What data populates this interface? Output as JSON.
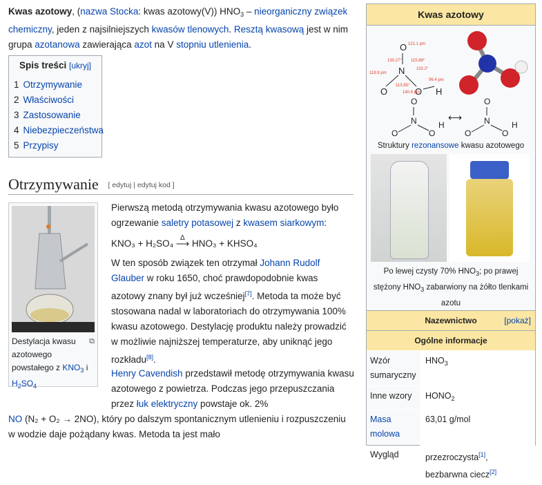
{
  "intro": {
    "title_bold": "Kwas azotowy",
    "p1": ", (",
    "stocka_link": "nazwa Stocka",
    "p2": ": kwas azotowy(V)) HNO",
    "p2_sub": "3",
    "p3": " – ",
    "link_nieorg": "nieorganiczny związek chemiczny",
    "p4": ", jeden z najsilniejszych ",
    "link_kwasow": "kwasów tlenowych",
    "p5": ". ",
    "link_reszta": "Resztą kwasową",
    "p6": " jest w nim grupa ",
    "link_azotanowa": "azotanowa",
    "p7": " zawierająca ",
    "link_azot": "azot",
    "p8": " na V ",
    "link_stopniu": "stopniu utlenienia",
    "p9": "."
  },
  "toc": {
    "title": "Spis treści",
    "toggle": "[ukryj]",
    "items": [
      {
        "num": "1",
        "label": "Otrzymywanie"
      },
      {
        "num": "2",
        "label": "Właściwości"
      },
      {
        "num": "3",
        "label": "Zastosowanie"
      },
      {
        "num": "4",
        "label": "Niebezpieczeństwa"
      },
      {
        "num": "5",
        "label": "Przypisy"
      }
    ]
  },
  "section": {
    "title": "Otrzymywanie",
    "edit": "[ edytuj | edytuj kod ]"
  },
  "thumb": {
    "caption1": "Destylacja kwasu azotowego powstałego z ",
    "caption_link": "KNO",
    "caption_sub": "3",
    "caption2": " i ",
    "caption_link2": "H",
    "caption_sub2": "2",
    "caption_link2b": "SO",
    "caption_sub3": "4"
  },
  "body": {
    "p1a": "Pierwszą metodą otrzymywania kwasu azotowego było ogrzewanie ",
    "p1_link1": "saletry potasowej",
    "p1b": " z ",
    "p1_link2": "kwasem siarkowym",
    "p1c": ":",
    "eq": "KNO₃ + H₂SO₄ ⟶ HNO₃ + KHSO₄",
    "eq_delta": "Δ",
    "p2a": "W ten sposób związek ten otrzymał ",
    "p2_link": "Johann Rudolf Glauber",
    "p2b": " w roku 1650, choć prawdopodobnie kwas azotowy znany był już wcześniej",
    "p2_ref1": "[7]",
    "p2c": ". Metoda ta może być stosowana nadal w laboratoriach do otrzymywania 100% kwasu azotowego. Destylację produktu należy prowadzić w możliwie najniższej temperaturze, aby uniknąć jego rozkładu",
    "p2_ref2": "[8]",
    "p2d": ".",
    "p3_link": "Henry Cavendish",
    "p3a": " przedstawił metodę otrzymywania kwasu azotowego z powietrza. Podczas jego przepuszczania przez ",
    "p3_link2": "łuk elektryczny",
    "p3b": " powstaje ok. 2%",
    "p4_link": "NO",
    "p4a": " (N₂ + O₂ → 2NO), który po dalszym spontanicznym utlenieniu i rozpuszczeniu w wodzie daje pożądany kwas. Metoda ta jest mało"
  },
  "infobox": {
    "title": "Kwas azotowy",
    "angles": [
      "130.27°",
      "121.1 pm",
      "115.88°",
      "102.2°",
      "119.9 pm",
      "113.85°",
      "140.6 pm",
      "96.4 pm"
    ],
    "atom_labels": {
      "O": "O",
      "N": "N",
      "H": "H"
    },
    "resonance_caption_a": "Struktury ",
    "resonance_link": "rezonansowe",
    "resonance_caption_b": " kwasu azotowego",
    "photo_caption_a": "Po lewej czysty 70% HNO",
    "photo_caption_sub": "3",
    "photo_caption_b": "; po prawej stężony HNO",
    "photo_caption_sub2": "3",
    "photo_caption_c": " zabarwiony na żółto tlenkami azotu",
    "nazewnictwo": "Nazewnictwo",
    "pokaz": "[pokaż]",
    "ogolne": "Ogólne informacje",
    "rows": [
      {
        "k": "Wzór sumaryczny",
        "v": "HNO",
        "vsub": "3"
      },
      {
        "k": "Inne wzory",
        "v": "HONO",
        "vsub": "2"
      },
      {
        "k": "Masa molowa",
        "v": "63,01 g/mol"
      },
      {
        "k": "Wygląd",
        "v": "przezroczysta",
        "ref1": "[1]",
        "v2": ", bezbarwna ciecz",
        "ref2": "[2]"
      }
    ]
  },
  "colors": {
    "link": "#0645ad",
    "visited": "#0b0080",
    "infobox_head": "#fbe7a3"
  }
}
